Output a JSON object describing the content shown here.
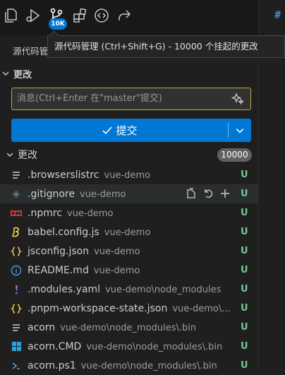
{
  "activity_bar": {
    "badge": "10K",
    "icons": [
      "explorer-icon",
      "run-debug-icon",
      "source-control-icon",
      "extensions-icon",
      "remote-icon",
      "share-icon"
    ]
  },
  "tooltip": "源代码管理 (Ctrl+Shift+G) - 10000 个挂起的更改",
  "view_title": "源代码管",
  "right_edge_hash": "#",
  "changes_section": {
    "label": "更改"
  },
  "commit": {
    "placeholder": "消息(Ctrl+Enter 在\"master\"提交)",
    "button_label": "提交"
  },
  "changes_group": {
    "label": "更改",
    "count": "10000"
  },
  "files": [
    {
      "name": ".browserslistrc",
      "dir": "vue-demo",
      "status": "U",
      "icon": "lines-icon",
      "icon_color": "#cccccc"
    },
    {
      "name": ".gitignore",
      "dir": "vue-demo",
      "status": "U",
      "icon": "git-icon",
      "icon_color": "#41535b"
    },
    {
      "name": ".npmrc",
      "dir": "vue-demo",
      "status": "U",
      "icon": "npm-icon",
      "icon_color": "#cb3837"
    },
    {
      "name": "babel.config.js",
      "dir": "vue-demo",
      "status": "U",
      "icon": "babel-icon",
      "icon_color": "#f5da55"
    },
    {
      "name": "jsconfig.json",
      "dir": "vue-demo",
      "status": "U",
      "icon": "json-icon",
      "icon_color": "#e8c54d"
    },
    {
      "name": "README.md",
      "dir": "vue-demo",
      "status": "U",
      "icon": "info-icon",
      "icon_color": "#4d9fd6"
    },
    {
      "name": ".modules.yaml",
      "dir": "vue-demo\\node_modules",
      "status": "U",
      "icon": "yaml-icon",
      "icon_color": "#a074c4"
    },
    {
      "name": ".pnpm-workspace-state.json",
      "dir": "vue-demo\\...",
      "status": "U",
      "icon": "json-icon",
      "icon_color": "#e8c54d"
    },
    {
      "name": "acorn",
      "dir": "vue-demo\\node_modules\\.bin",
      "status": "U",
      "icon": "lines-icon",
      "icon_color": "#cccccc"
    },
    {
      "name": "acorn.CMD",
      "dir": "vue-demo\\node_modules\\.bin",
      "status": "U",
      "icon": "windows-icon",
      "icon_color": "#2a9fe0"
    },
    {
      "name": "acorn.ps1",
      "dir": "vue-demo\\node_modules\\.bin",
      "status": "U",
      "icon": "powershell-icon",
      "icon_color": "#4d9fd6"
    }
  ],
  "colors": {
    "accent": "#0078d4",
    "untracked": "#73c991",
    "input_focus_border": "#c8a23a"
  }
}
